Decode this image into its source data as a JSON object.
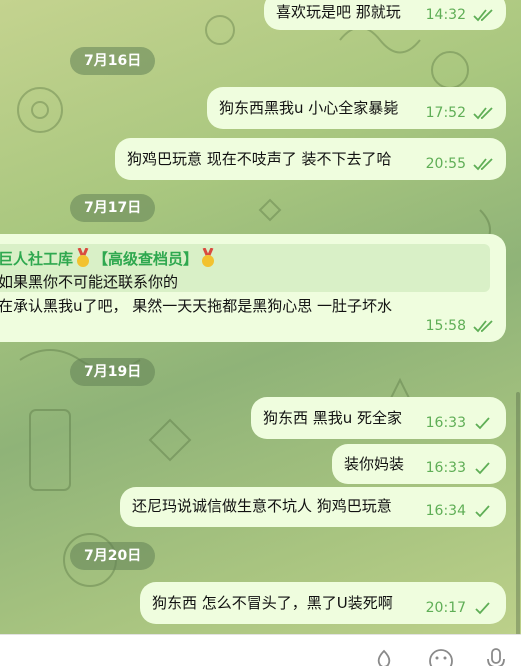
{
  "colors": {
    "bubble": "#effdde",
    "time": "#5fae56",
    "sender": "#2fa84f",
    "date_pill": "#6a8a58"
  },
  "messages": [
    {
      "text": "喜欢玩是吧 那就玩",
      "time": "14:32",
      "status": "read"
    },
    {
      "date": "7月16日"
    },
    {
      "text": "狗东西黑我u 小心全家暴毙",
      "time": "17:52",
      "status": "read"
    },
    {
      "text": "狗鸡巴玩意 现在不吱声了 装不下去了哈",
      "time": "20:55",
      "status": "read"
    },
    {
      "date": "7月17日"
    },
    {
      "forwarded": {
        "sender": "巨人社工库",
        "badge": "【高级查档员】",
        "quote": "如果黑你不可能还联系你的"
      },
      "text": "在承认黑我u了吧， 果然一天天拖都是黑狗心思 一肚子坏水",
      "time": "15:58",
      "status": "read"
    },
    {
      "date": "7月19日"
    },
    {
      "text": "狗东西 黑我u 死全家",
      "time": "16:33",
      "status": "sent"
    },
    {
      "text": "装你妈装",
      "time": "16:33",
      "status": "sent"
    },
    {
      "text": "还尼玛说诚信做生意不坑人 狗鸡巴玩意",
      "time": "16:34",
      "status": "sent"
    },
    {
      "date": "7月20日"
    },
    {
      "text": "狗东西 怎么不冒头了，黑了U装死啊",
      "time": "20:17",
      "status": "sent"
    }
  ],
  "bottom_bar": {
    "icons": [
      "fire-reaction-icon",
      "emoji-icon",
      "microphone-icon"
    ]
  }
}
